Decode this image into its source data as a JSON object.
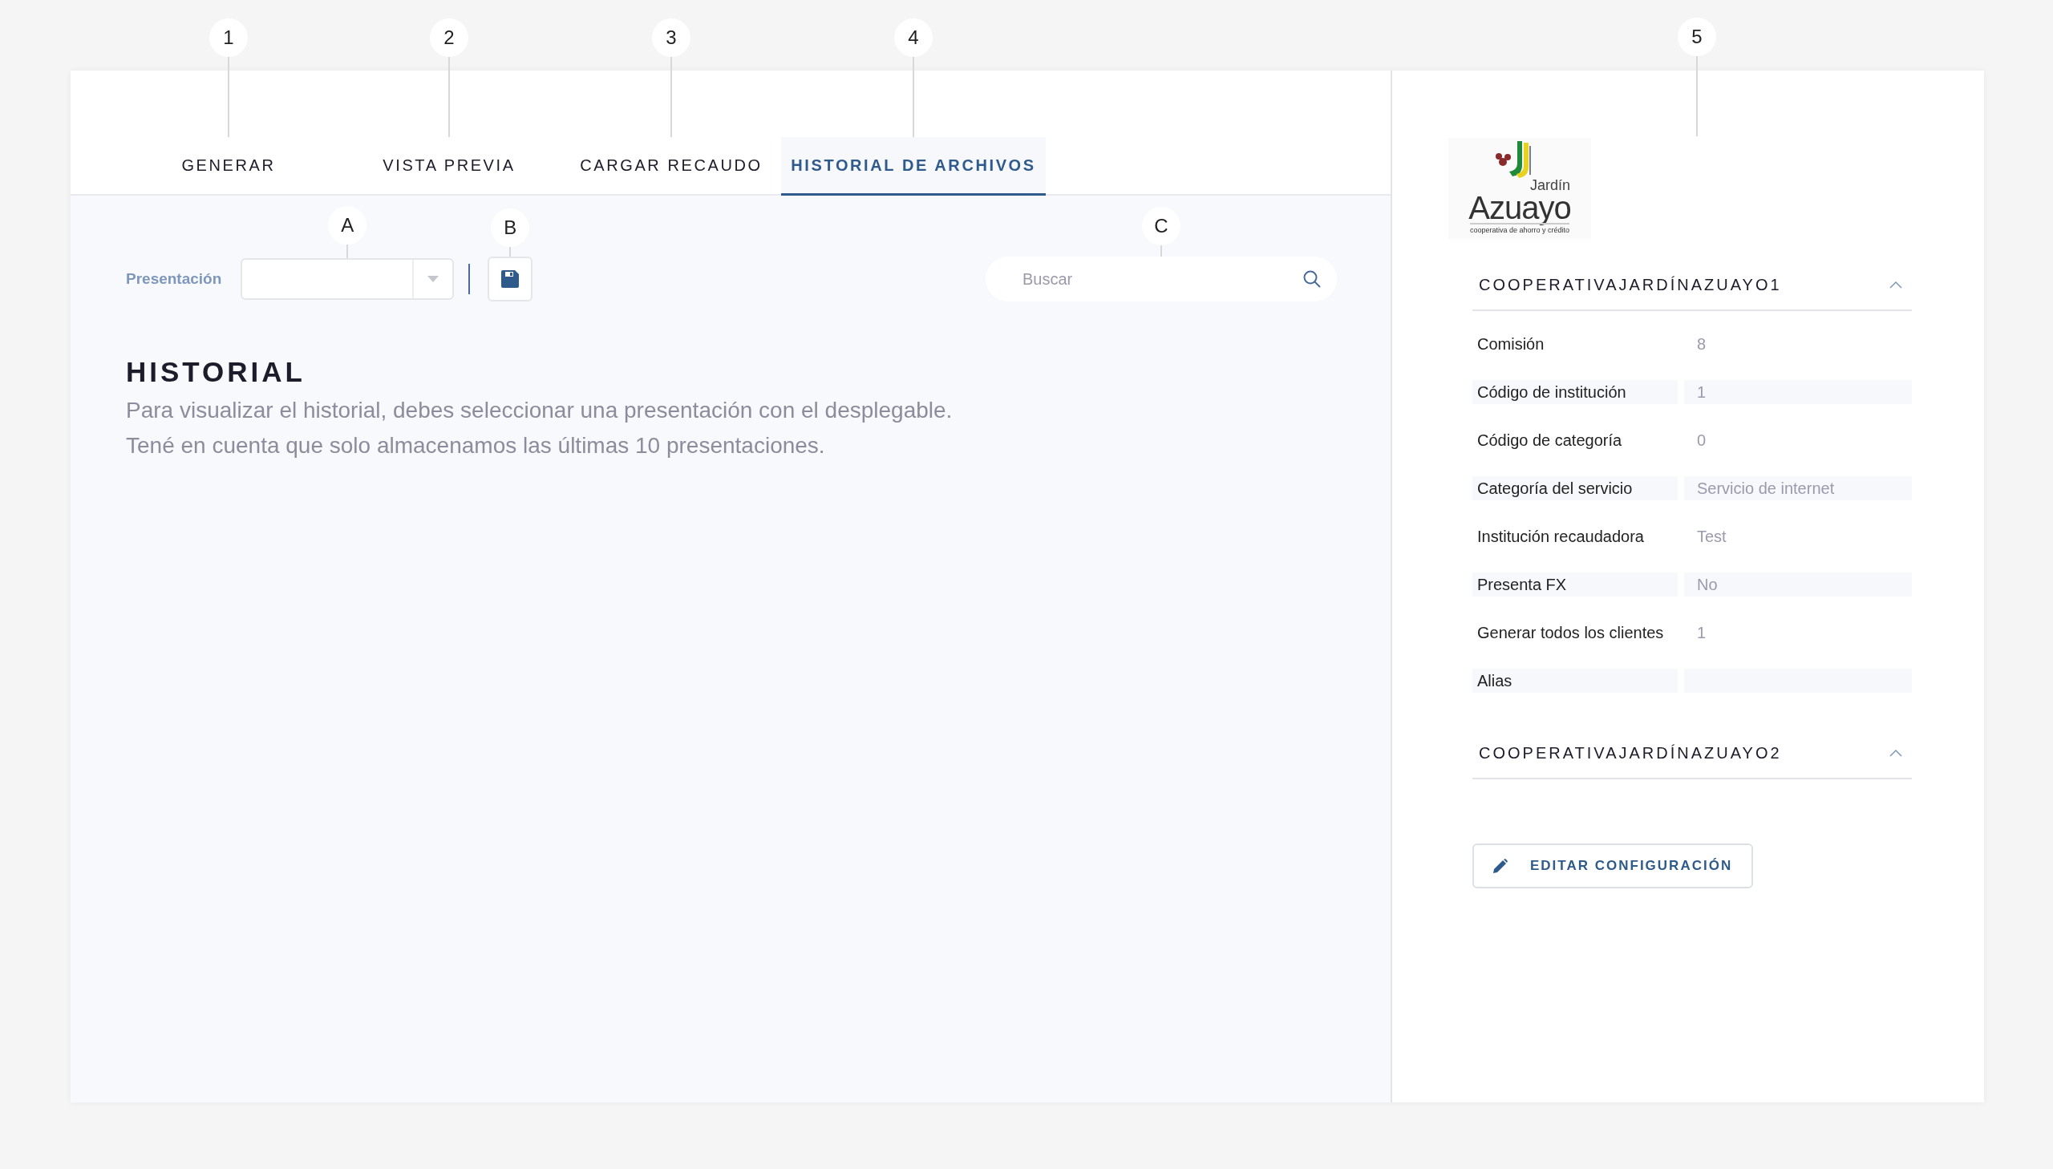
{
  "tabs": [
    {
      "label": "GENERAR",
      "selected": false,
      "callout": "1"
    },
    {
      "label": "VISTA PREVIA",
      "selected": false,
      "callout": "2"
    },
    {
      "label": "CARGAR RECAUDO",
      "selected": false,
      "callout": "3"
    },
    {
      "label": "HISTORIAL DE ARCHIVOS",
      "selected": true,
      "callout": "4"
    }
  ],
  "toolbar": {
    "label": "Presentación",
    "select_callout": "A",
    "save_callout": "B",
    "search": {
      "placeholder": "Buscar",
      "callout": "C"
    }
  },
  "history": {
    "title": "HISTORIAL",
    "lines": [
      "Para visualizar el historial, debes seleccionar una presentación con el desplegable.",
      "Tené en cuenta que solo almacenamos las últimas 10 presentaciones."
    ]
  },
  "sidebar": {
    "callout": "5",
    "logo": {
      "name": "Jardín",
      "brand": "Azuayo",
      "tagline": "cooperativa de ahorro y crédito"
    },
    "sections": [
      {
        "title": "COOPERATIVAJARDÍNAZUAYO1",
        "rows": [
          {
            "label": "Comisión",
            "value": "8"
          },
          {
            "label": "Código de institución",
            "value": "1"
          },
          {
            "label": "Código de categoría",
            "value": "0"
          },
          {
            "label": "Categoría del servicio",
            "value": "Servicio de internet"
          },
          {
            "label": "Institución recaudadora",
            "value": "Test"
          },
          {
            "label": "Presenta FX",
            "value": "No"
          },
          {
            "label": "Generar todos los clientes",
            "value": "1"
          },
          {
            "label": "Alias"
          }
        ]
      },
      {
        "title": "COOPERATIVAJARDÍNAZUAYO2"
      }
    ],
    "edit_button": "EDITAR CONFIGURACIÓN"
  }
}
